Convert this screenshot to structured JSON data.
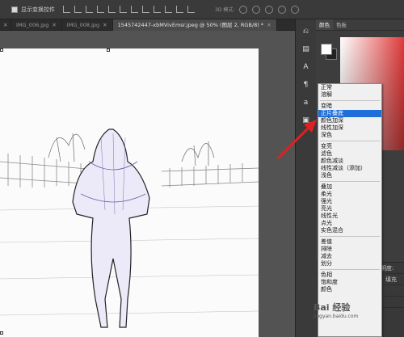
{
  "options_bar": {
    "show_transform_controls_label": "显示变换控件",
    "mode_3d_label": "3D 模式:"
  },
  "document_tabs": [
    {
      "label": "IMG_006.jpg",
      "active": false
    },
    {
      "label": "IMG_008.jpg",
      "active": false
    },
    {
      "label": "1545742447-xbMVivEmsr.jpeg @ 50% (图层 2, RGB/8) *",
      "active": true
    }
  ],
  "color_panel": {
    "tabs": [
      "颜色",
      "色板"
    ],
    "accent_color": "#e03a3a"
  },
  "blend_mode_menu": {
    "groups": [
      [
        "正常",
        "溶解"
      ],
      [
        "变暗",
        "正片叠底",
        "颜色加深",
        "线性加深",
        "深色"
      ],
      [
        "变亮",
        "滤色",
        "颜色减淡",
        "线性减淡（添加）",
        "浅色"
      ],
      [
        "叠加",
        "柔光",
        "强光",
        "亮光",
        "线性光",
        "点光",
        "实色混合"
      ],
      [
        "差值",
        "排除",
        "减去",
        "划分"
      ],
      [
        "色相",
        "饱和度",
        "颜色"
      ]
    ],
    "selected": "正片叠底",
    "selected_color": "#1e6fd9"
  },
  "layers_panel": {
    "opacity_label": "不透明度:",
    "fill_label": "填充"
  },
  "annotation": {
    "arrow_color": "#e02020"
  },
  "watermark": {
    "text": "Bai 经验",
    "sub": "jingyan.baidu.com"
  }
}
